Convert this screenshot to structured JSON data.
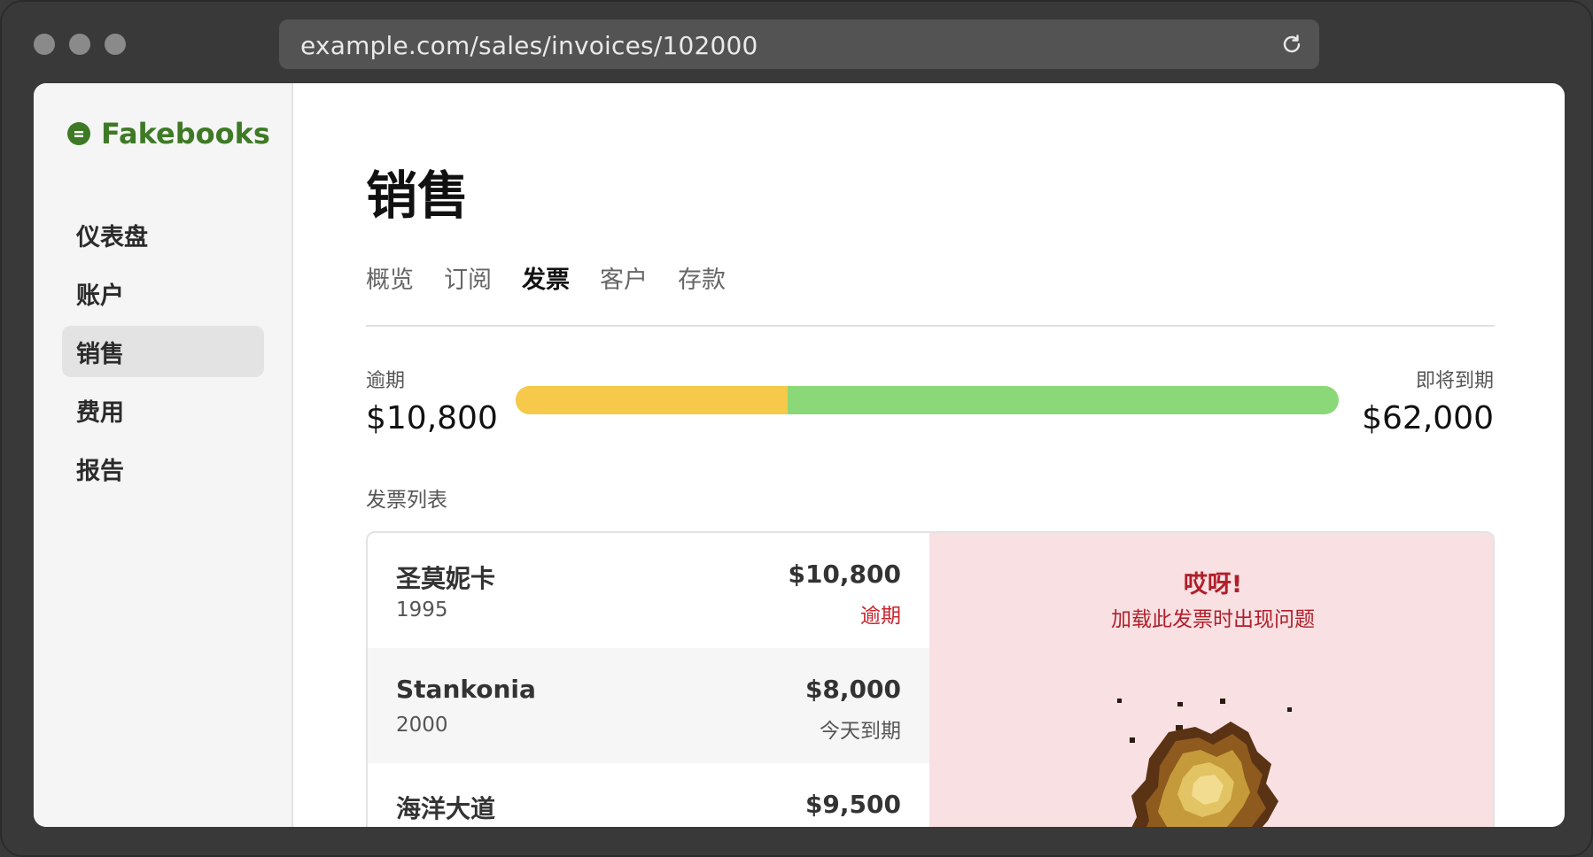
{
  "browser": {
    "url": "example.com/sales/invoices/102000"
  },
  "sidebar": {
    "brand": "Fakebooks",
    "items": [
      {
        "label": "仪表盘"
      },
      {
        "label": "账户"
      },
      {
        "label": "销售"
      },
      {
        "label": "费用"
      },
      {
        "label": "报告"
      }
    ],
    "active_index": 2
  },
  "main": {
    "title": "销售",
    "tabs": [
      {
        "label": "概览"
      },
      {
        "label": "订阅"
      },
      {
        "label": "发票"
      },
      {
        "label": "客户"
      },
      {
        "label": "存款"
      }
    ],
    "active_tab_index": 2,
    "summary": {
      "overdue_label": "逾期",
      "overdue_amount": "$10,800",
      "due_soon_label": "即将到期",
      "due_soon_amount": "$62,000",
      "overdue_fraction": 0.33
    },
    "invoice_list_label": "发票列表",
    "invoices": [
      {
        "name": "圣莫妮卡",
        "year": "1995",
        "amount": "$10,800",
        "status": "逾期",
        "status_type": "overdue"
      },
      {
        "name": "Stankonia",
        "year": "2000",
        "amount": "$8,000",
        "status": "今天到期",
        "status_type": "due"
      },
      {
        "name": "海洋大道",
        "year": "",
        "amount": "$9,500",
        "status": "",
        "status_type": "due"
      }
    ],
    "error": {
      "title": "哎呀!",
      "message": "加载此发票时出现问题"
    }
  },
  "colors": {
    "brand": "#3e7a26",
    "overdue": "#f6c94b",
    "due_soon": "#8ad877",
    "error_bg": "#f9e0e3",
    "error_text": "#b01f2a"
  }
}
